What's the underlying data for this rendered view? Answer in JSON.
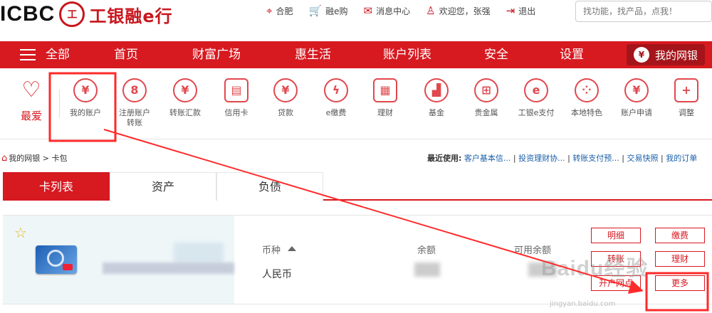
{
  "header": {
    "logo_text": "ICBC",
    "logo_mark": "工",
    "logo_cn": "工银融e行",
    "links": [
      {
        "icon": "location-icon",
        "glyph": "⌖",
        "label": "合肥"
      },
      {
        "icon": "cart-icon",
        "glyph": "🛒",
        "label": "融e购"
      },
      {
        "icon": "mail-icon",
        "glyph": "✉",
        "label": "消息中心"
      },
      {
        "icon": "user-icon",
        "glyph": "♙",
        "label": "欢迎您，张强"
      },
      {
        "icon": "logout-icon",
        "glyph": "⇥",
        "label": "退出"
      }
    ],
    "search_placeholder": "找功能，找产品，点我！"
  },
  "nav": {
    "menu_label": "全部",
    "items": [
      "首页",
      "财富广场",
      "惠生活",
      "账户列表",
      "安全",
      "设置"
    ],
    "mybank_label": "我的网银"
  },
  "functions": {
    "favorites_label": "最爱",
    "items": [
      {
        "icon": "yuan-icon",
        "glyph": "¥",
        "label": "我的账户"
      },
      {
        "icon": "register-account-icon",
        "glyph": "8",
        "label": "注册账户\n转账"
      },
      {
        "icon": "transfer-icon",
        "glyph": "¥",
        "label": "转账汇款"
      },
      {
        "icon": "credit-card-icon",
        "glyph": "▤",
        "label": "信用卡"
      },
      {
        "icon": "loan-bag-icon",
        "glyph": "¥",
        "label": "贷款"
      },
      {
        "icon": "payment-drop-icon",
        "glyph": "ϟ",
        "label": "e缴费"
      },
      {
        "icon": "finance-icon",
        "glyph": "▦",
        "label": "理财"
      },
      {
        "icon": "fund-chart-icon",
        "glyph": "▟",
        "label": "基金"
      },
      {
        "icon": "precious-metal-icon",
        "glyph": "⊞",
        "label": "贵金属"
      },
      {
        "icon": "e-pay-icon",
        "glyph": "e",
        "label": "工银e支付"
      },
      {
        "icon": "local-feature-icon",
        "glyph": "⁘",
        "label": "本地特色"
      },
      {
        "icon": "account-apply-icon",
        "glyph": "¥",
        "label": "账户申请"
      },
      {
        "icon": "adjust-icon",
        "glyph": "+",
        "label": "调整"
      }
    ]
  },
  "breadcrumb": "我的网银 > 卡包",
  "recent": {
    "label": "最近使用:",
    "links": [
      "客户基本信...",
      "投资理财协...",
      "转账支付预...",
      "交易快照",
      "我的订单"
    ]
  },
  "tabs": [
    "卡列表",
    "资产",
    "负债"
  ],
  "card_table": {
    "headers": {
      "currency": "币种",
      "balance": "余额",
      "available": "可用余额"
    },
    "currency_value": "人民币",
    "actions": [
      "明细",
      "缴费",
      "转账",
      "理财",
      "开户网点",
      "更多"
    ]
  },
  "watermark": {
    "main": "Baidu经验",
    "sub": "jingyan.baidu.com"
  },
  "colors": {
    "brand_red": "#d71920",
    "annotation_red": "#ff2a2a"
  }
}
